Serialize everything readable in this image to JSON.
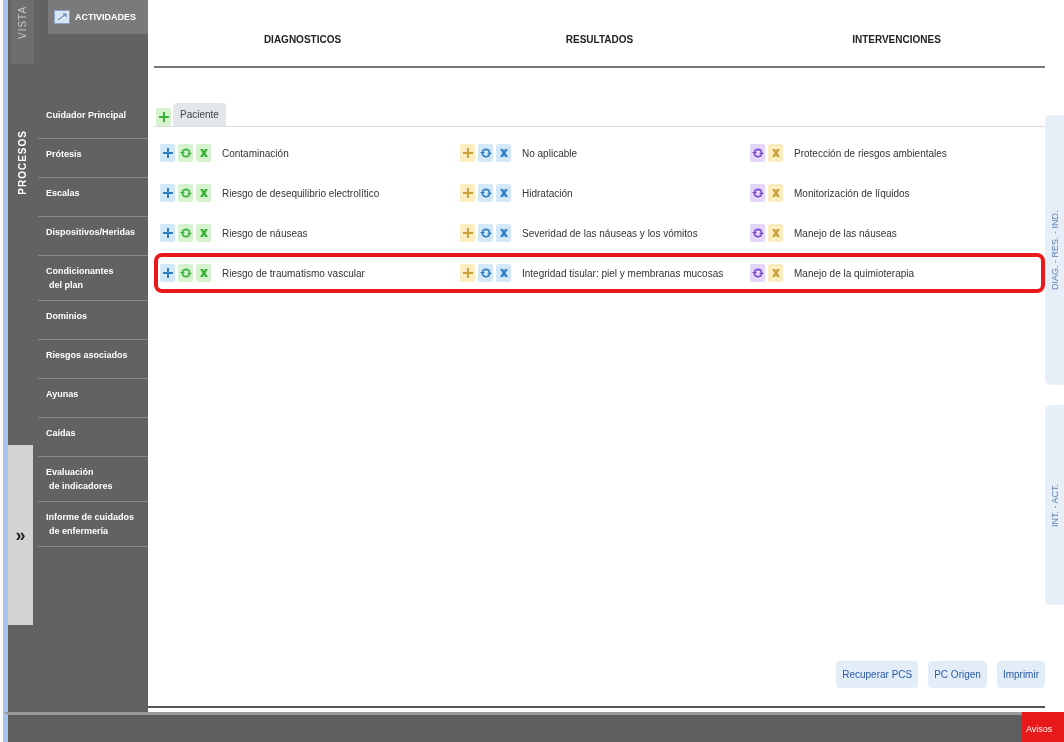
{
  "left_tabs": [
    {
      "label": "VISTA",
      "selected": false
    },
    {
      "label": "PROCESOS",
      "selected": true
    }
  ],
  "sidebar": {
    "header": "ACTIVIDADES",
    "items": [
      {
        "lines": [
          "Cuidador Principal"
        ]
      },
      {
        "lines": [
          "Prótesis"
        ]
      },
      {
        "lines": [
          "Escalas"
        ]
      },
      {
        "lines": [
          "Dispositivos/Heridas"
        ]
      },
      {
        "lines": [
          "Condicionantes",
          "del plan"
        ]
      },
      {
        "lines": [
          "Dominios"
        ]
      },
      {
        "lines": [
          "Riesgos asociados"
        ]
      },
      {
        "lines": [
          "Ayunas"
        ]
      },
      {
        "lines": [
          "Caídas"
        ]
      },
      {
        "lines": [
          "Evaluación",
          "de indicadores"
        ]
      },
      {
        "lines": [
          "Informe de cuidados",
          "de enfermería"
        ]
      }
    ],
    "expand_handle": "»"
  },
  "columns": [
    "DIAGNOSTICOS",
    "RESULTADOS",
    "INTERVENCIONES"
  ],
  "tabs": [
    {
      "label": "Paciente",
      "selected": true
    }
  ],
  "rows": [
    {
      "diagnostico": "Contaminación",
      "resultado": "No aplicable",
      "intervencion": "Protección de riesgos ambientales",
      "highlighted": false
    },
    {
      "diagnostico": "Riesgo de desequilibrio electrolítico",
      "resultado": "Hidratación",
      "intervencion": "Monitorización de líquidos",
      "highlighted": false
    },
    {
      "diagnostico": "Riesgo de náuseas",
      "resultado": "Severidad de las náuseas y los vómitos",
      "intervencion": "Manejo de las náuseas",
      "highlighted": false
    },
    {
      "diagnostico": "Riesgo de traumatismo vascular",
      "resultado": "Integridad tisular: piel y membranas mucosas",
      "intervencion": "Manejo de la quimioterapia",
      "highlighted": true
    }
  ],
  "right_tabs": [
    {
      "label": "DIAG. - RES. - IND."
    },
    {
      "label": "INT. - ACT."
    }
  ],
  "buttons": [
    "Recuperar PCS",
    "PC Origen",
    "Imprimir"
  ],
  "status_bar": {
    "alert": "Avisos"
  }
}
